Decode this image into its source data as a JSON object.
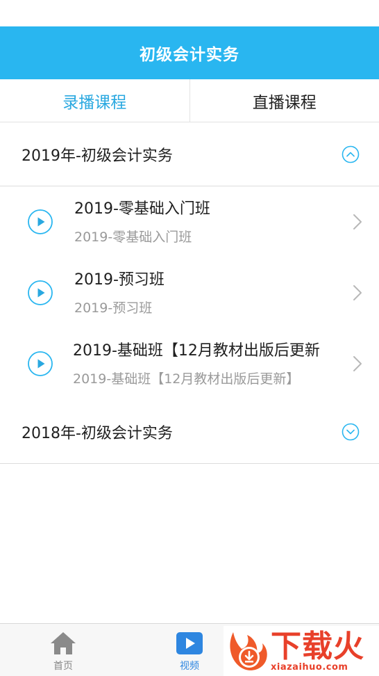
{
  "header": {
    "title": "初级会计实务"
  },
  "tabs": [
    {
      "label": "录播课程",
      "active": true
    },
    {
      "label": "直播课程",
      "active": false
    }
  ],
  "groups": [
    {
      "title": "2019年-初级会计实务",
      "expanded": true,
      "items": [
        {
          "title": "2019-零基础入门班",
          "subtitle": "2019-零基础入门班"
        },
        {
          "title": "2019-预习班",
          "subtitle": "2019-预习班"
        },
        {
          "title": "2019-基础班【12月教材出版后更新",
          "subtitle": "2019-基础班【12月教材出版后更新】"
        }
      ]
    },
    {
      "title": "2018年-初级会计实务",
      "expanded": false,
      "items": []
    }
  ],
  "bottom_nav": [
    {
      "label": "首页",
      "icon": "home-icon",
      "active": false
    },
    {
      "label": "视频",
      "icon": "video-play-icon",
      "active": true
    }
  ],
  "watermark": {
    "text": "下载火",
    "url": "xiazaihuo.com"
  },
  "colors": {
    "primary": "#29b6f0",
    "tab_active": "#29a8e0",
    "nav_active": "#2e86e0",
    "watermark": "#e8402a"
  }
}
